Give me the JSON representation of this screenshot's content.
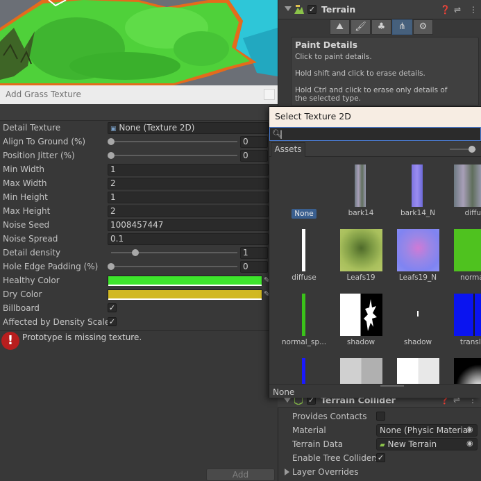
{
  "inspector": {
    "terrain_title": "Terrain",
    "paint_details": {
      "heading": "Paint Details",
      "lines": [
        "Click to paint details.",
        "Hold shift and click to erase details.",
        "Hold Ctrl and click to erase only details of the selected type."
      ]
    },
    "terrain_collider": {
      "title": "Terrain Collider",
      "props": {
        "provides_contacts": "Provides Contacts",
        "material_label": "Material",
        "material_value": "None (Physic Material",
        "terrain_data_label": "Terrain Data",
        "terrain_data_value": "New Terrain",
        "enable_tree_colliders": "Enable Tree Colliders",
        "layer_overrides": "Layer Overrides"
      }
    }
  },
  "grass_window": {
    "title": "Add Grass Texture",
    "labels": {
      "detail_texture": "Detail Texture",
      "align_to_ground": "Align To Ground (%)",
      "position_jitter": "Position Jitter (%)",
      "min_width": "Min Width",
      "max_width": "Max Width",
      "min_height": "Min Height",
      "max_height": "Max Height",
      "noise_seed": "Noise Seed",
      "noise_spread": "Noise Spread",
      "detail_density": "Detail density",
      "hole_edge_padding": "Hole Edge Padding (%)",
      "healthy_color": "Healthy Color",
      "dry_color": "Dry Color",
      "billboard": "Billboard",
      "affected_by_density_scale": "Affected by Density Scale"
    },
    "values": {
      "detail_texture": "None (Texture 2D)",
      "align_to_ground": "0",
      "position_jitter": "0",
      "min_width": "1",
      "max_width": "2",
      "min_height": "1",
      "max_height": "2",
      "noise_seed": "1008457447",
      "noise_spread": "0.1",
      "detail_density": "1",
      "hole_edge_padding": "0"
    },
    "sliders": {
      "align_to_ground": 0,
      "position_jitter": 0,
      "detail_density": 0.2,
      "hole_edge_padding": 0
    },
    "colors": {
      "healthy": "#3ee52c",
      "dry": "#d1b822"
    },
    "billboard_checked": true,
    "density_scale_checked": true,
    "error_message": "Prototype is missing texture.",
    "add_button": "Add"
  },
  "picker": {
    "title": "Select Texture 2D",
    "search_value": "",
    "tab": "Assets",
    "footer": "None",
    "items": [
      {
        "label": "None",
        "selected": true
      },
      {
        "label": "bark14"
      },
      {
        "label": "bark14_N"
      },
      {
        "label": "diffus"
      },
      {
        "label": "diffuse"
      },
      {
        "label": "Leafs19"
      },
      {
        "label": "Leafs19_N"
      },
      {
        "label": "normal_"
      },
      {
        "label": "normal_sp..."
      },
      {
        "label": "shadow"
      },
      {
        "label": "shadow"
      },
      {
        "label": "transluc"
      }
    ]
  }
}
